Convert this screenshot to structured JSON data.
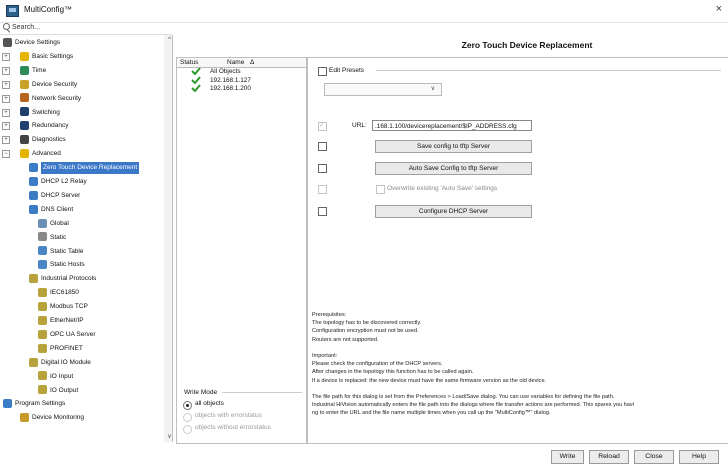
{
  "window": {
    "title": "MultiConfig™",
    "close_glyph": "×"
  },
  "search": {
    "placeholder": "Search..."
  },
  "tree": {
    "nodes": [
      {
        "label": "Device Settings",
        "icon": "device-settings-icon",
        "level": 0
      },
      {
        "label": "Basic Settings",
        "icon": "star-icon",
        "level": 1
      },
      {
        "label": "Time",
        "icon": "clock-icon",
        "level": 1
      },
      {
        "label": "Device Security",
        "icon": "lock-icon",
        "level": 1
      },
      {
        "label": "Network Security",
        "icon": "firewall-icon",
        "level": 1
      },
      {
        "label": "Switching",
        "icon": "switching-icon",
        "level": 1
      },
      {
        "label": "Redundancy",
        "icon": "redundancy-icon",
        "level": 1
      },
      {
        "label": "Diagnostics",
        "icon": "diagnostics-icon",
        "level": 1
      },
      {
        "label": "Advanced",
        "icon": "star-icon",
        "level": 1
      },
      {
        "label": "Zero Touch Device Replacement",
        "icon": "replacement-icon",
        "level": 2,
        "selected": true
      },
      {
        "label": "DHCP L2 Relay",
        "icon": "dhcp-relay-icon",
        "level": 2
      },
      {
        "label": "DHCP Server",
        "icon": "dhcp-server-icon",
        "level": 2
      },
      {
        "label": "DNS Client",
        "icon": "dns-icon",
        "level": 2
      },
      {
        "label": "Global",
        "icon": "global-icon",
        "level": 3
      },
      {
        "label": "Static",
        "icon": "static-icon",
        "level": 3
      },
      {
        "label": "Static Table",
        "icon": "table-icon",
        "level": 3
      },
      {
        "label": "Static Hosts",
        "icon": "hosts-icon",
        "level": 3
      },
      {
        "label": "Industrial Protocols",
        "icon": "protocol-icon",
        "level": 2
      },
      {
        "label": "IEC61850",
        "icon": "protocol-icon",
        "level": 3
      },
      {
        "label": "Modbus TCP",
        "icon": "protocol-icon",
        "level": 3
      },
      {
        "label": "EtherNet/IP",
        "icon": "protocol-icon",
        "level": 3
      },
      {
        "label": "OPC UA Server",
        "icon": "protocol-icon",
        "level": 3
      },
      {
        "label": "PROFINET",
        "icon": "protocol-icon",
        "level": 3
      },
      {
        "label": "Digital IO Module",
        "icon": "protocol-icon",
        "level": 2
      },
      {
        "label": "IO Input",
        "icon": "protocol-icon",
        "level": 3
      },
      {
        "label": "IO Output",
        "icon": "protocol-icon",
        "level": 3
      },
      {
        "label": "Program Settings",
        "icon": "program-icon",
        "level": 0
      },
      {
        "label": "Device Monitoring",
        "icon": "monitoring-icon",
        "level": 1
      }
    ]
  },
  "status_table": {
    "headers": {
      "status": "Status",
      "name": "Name"
    },
    "sort_glyph": "Δ",
    "rows": [
      {
        "status": "ok",
        "name": "All Objects"
      },
      {
        "status": "ok",
        "name": "192.168.1.127"
      },
      {
        "status": "ok",
        "name": "192.168.1.200"
      }
    ]
  },
  "write_mode": {
    "label": "Write Mode",
    "options": [
      {
        "label": "all objects",
        "selected": true,
        "enabled": true
      },
      {
        "label": "objects with errorstatus",
        "selected": false,
        "enabled": false
      },
      {
        "label": "objects without errorstatus",
        "selected": false,
        "enabled": false
      }
    ]
  },
  "panel": {
    "title": "Zero Touch Device Replacement",
    "edit_presets": "Edit Presets",
    "url_label": "URL:",
    "url_value": ".168.1.100/devicereplacement/$IP_ADDRESS.cfg",
    "save_tftp": "Save config to tftp Server",
    "auto_save": "Auto Save Config to tftp Server",
    "overwrite": "Overwrite existing 'Auto Save' settings",
    "configure_dhcp": "Configure DHCP Server",
    "notes": [
      "Prerequisites:",
      "The topology has to be discovered correctly.",
      "Configuration encryption must not be used.",
      "Routers are not supported.",
      "",
      "Important:",
      "Please check the configuration of the DHCP servers.",
      "After changes in the topology this function has to be called again.",
      "If a device is replaced: the new device must have the same firmware version as the old device.",
      "",
      "The file path for this dialog is set from the Preferences > Load/Save dialog. You can use variables for defining the file path.",
      "Industrial HiVision automatically enters the file path into the dialogs where file transfer actions are performed. This spares you havi",
      "ng to enter the URL and the file name multiple times when you call up the \"MultiConfig™\" dialog."
    ]
  },
  "footer": {
    "write": "Write",
    "reload": "Reload",
    "close": "Close",
    "help": "Help"
  },
  "colors": {
    "selection": "#3c78c8",
    "check": "#2e9b2e"
  }
}
